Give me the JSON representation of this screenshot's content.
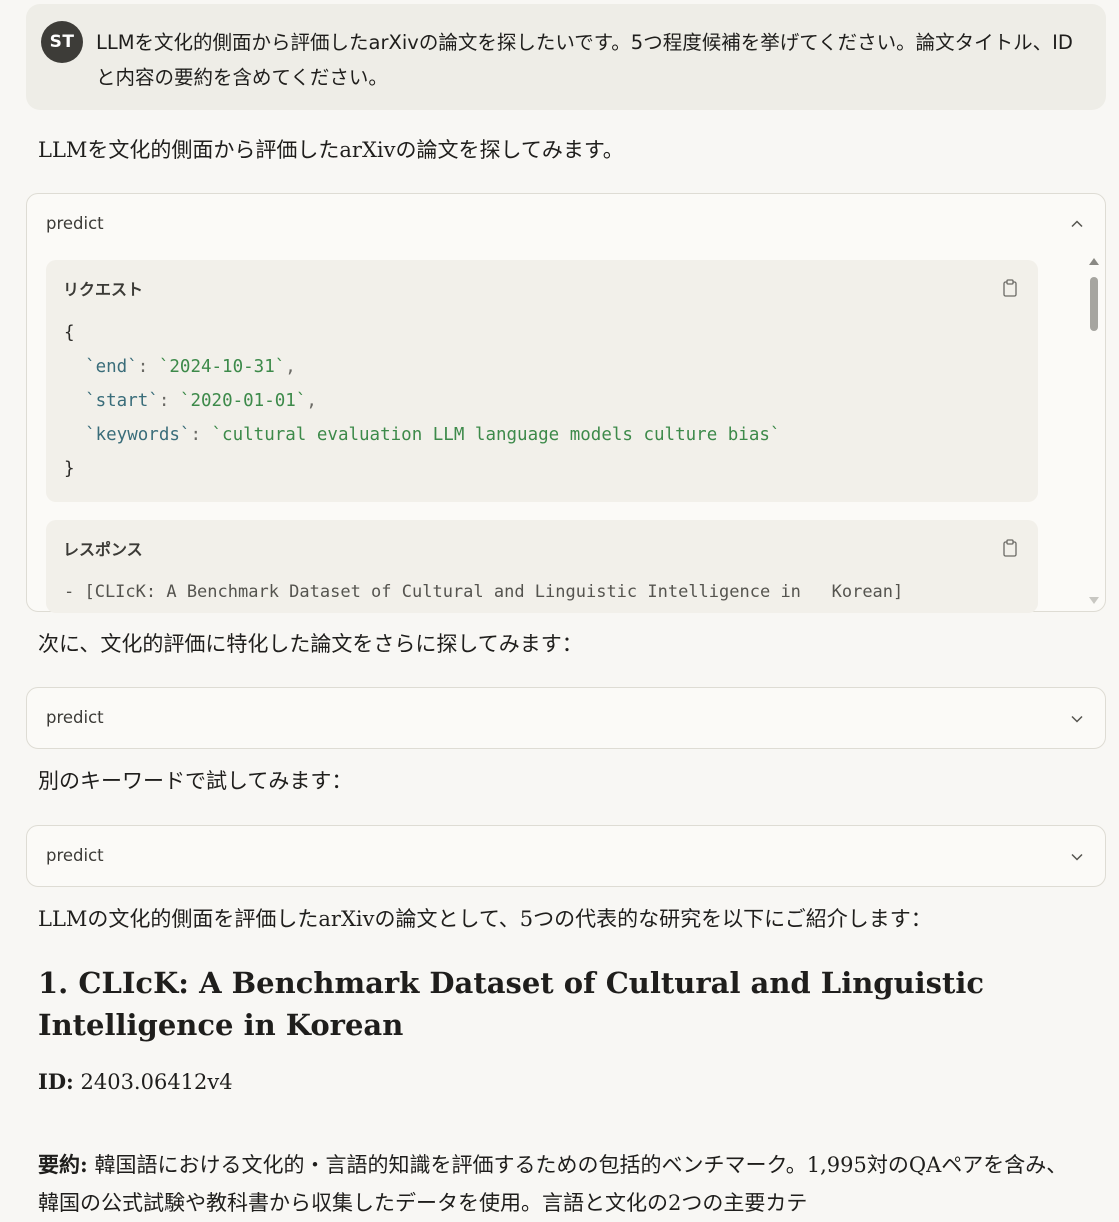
{
  "user": {
    "initials": "ST",
    "message": "LLMを文化的側面から評価したarXivの論文を探したいです。5つ程度候補を挙げてください。論文タイトル、IDと内容の要約を含めてください。"
  },
  "assistant": {
    "intro": "LLMを文化的側面から評価したarXivの論文を探してみます。",
    "tool1": {
      "name": "predict",
      "request_label": "リクエスト",
      "request_lines": {
        "open": "{",
        "end_key": "`end`",
        "end_val": "`2024-10-31`",
        "start_key": "`start`",
        "start_val": "`2020-01-01`",
        "keywords_key": "`keywords`",
        "keywords_val": "`cultural evaluation LLM language models culture bias`",
        "close": "}"
      },
      "response_label": "レスポンス",
      "response_line": "- [CLIcK: A Benchmark Dataset of Cultural and Linguistic Intelligence in   Korean]"
    },
    "text2": "次に、文化的評価に特化した論文をさらに探してみます：",
    "tool2": {
      "name": "predict"
    },
    "text3": "別のキーワードで試してみます：",
    "tool3": {
      "name": "predict"
    },
    "text4": "LLMの文化的側面を評価したarXivの論文として、5つの代表的な研究を以下にご紹介します：",
    "paper1": {
      "heading": "1. CLIcK: A Benchmark Dataset of Cultural and Linguistic Intelligence in Korean",
      "id_label": "ID:",
      "id_value": "2403.06412v4",
      "summary_label": "要約:",
      "summary_text": "韓国語における文化的・言語的知識を評価するための包括的ベンチマーク。1,995対のQAペアを含み、韓国の公式試験や教科書から収集したデータを使用。言語と文化の2つの主要カテ"
    }
  }
}
